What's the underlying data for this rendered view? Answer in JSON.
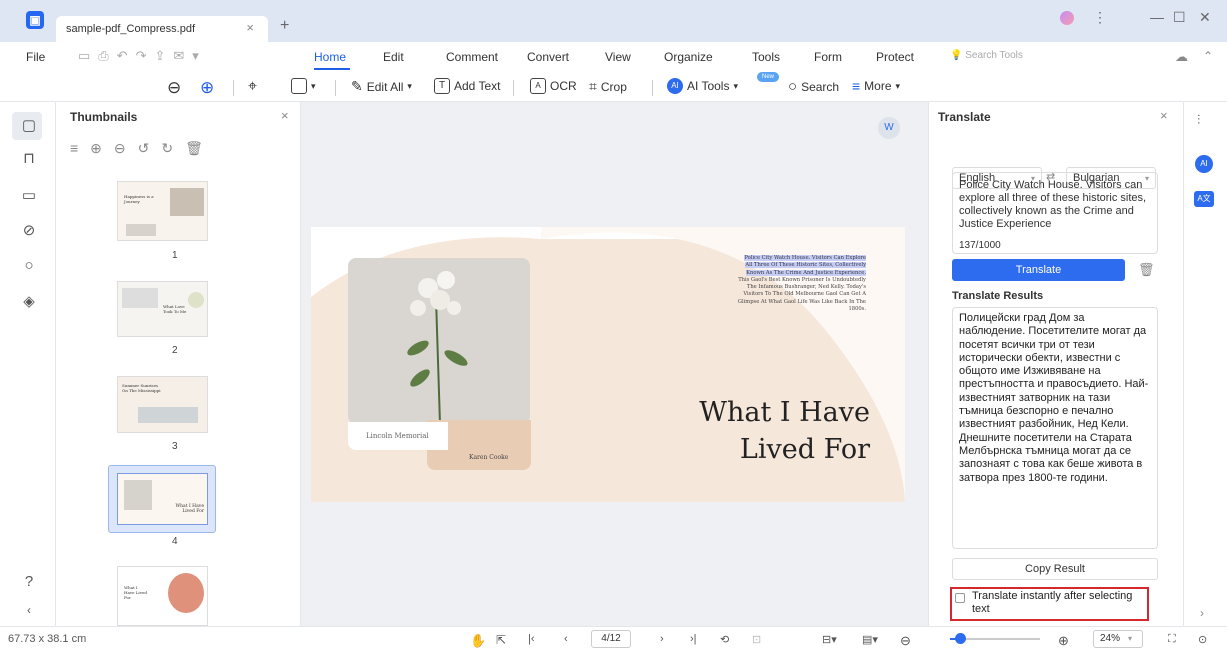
{
  "window": {
    "tab_title": "sample-pdf_Compress.pdf"
  },
  "menubar": {
    "items": [
      "File",
      "Home",
      "Edit",
      "Comment",
      "Convert",
      "View",
      "Organize",
      "Tools",
      "Form",
      "Protect"
    ],
    "search_placeholder": "Search Tools"
  },
  "toolbar": {
    "edit_all": "Edit All",
    "add_text": "Add Text",
    "ocr": "OCR",
    "crop": "Crop",
    "ai_tools": "AI Tools",
    "search": "Search",
    "more": "More",
    "new_badge": "New"
  },
  "thumbnails": {
    "title": "Thumbnails",
    "pages": [
      "1",
      "2",
      "3",
      "4"
    ],
    "selected_page": 4,
    "page1_text": "Happiness is a Journey",
    "page2_text": "What Love Took To Me",
    "page3_text": "Summer Sunrises On The Mississippi",
    "page4_text": "What I Have Lived For",
    "page5_text": "What I Have Lived For"
  },
  "document": {
    "title_line1": "What I Have",
    "title_line2": "Lived For",
    "highlighted": "Police City Watch House. Visitors Can Explore All Three Of These Historic Sites, Collectively Known As The Crime And Justice Experience.",
    "body": " This Gaol's Best Known Prisoner Is Undoubtedly The Infamous Bushranger, Ned Kelly. Today's Visitors To The Old Melbourne Gaol Can Get A Glimpse At What Gaol Life Was Like Back In The 1800s.",
    "caption": "Lincoln Memorial",
    "author": "Karen Cooke"
  },
  "translate": {
    "title": "Translate",
    "source_lang": "English",
    "target_lang": "Bulgarian",
    "source_text": "Police City Watch House. Visitors can explore all three of these historic sites, collectively known as the Crime and Justice Experience",
    "char_count": "137/1000",
    "translate_button": "Translate",
    "results_label": "Translate Results",
    "result_text": "Полицейски град Дом за наблюдение. Посетителите могат да посетят всички три от тези исторически обекти, известни с общото име Изживяване на престъпността и правосъдието. Най-известният затворник на тази тъмница безспорно е печално известният разбойник, Нед Кели. Днешните посетители на Старата Мелбърнска тъмница могат да се запознаят с това как беше живота в затвора през 1800-те години.",
    "copy_button": "Copy Result",
    "instant_label_1": "Translate instantly after selecting",
    "instant_label_2": "text"
  },
  "statusbar": {
    "dimensions": "67.73 x 38.1 cm",
    "page_indicator": "4/12",
    "zoom": "24%"
  }
}
